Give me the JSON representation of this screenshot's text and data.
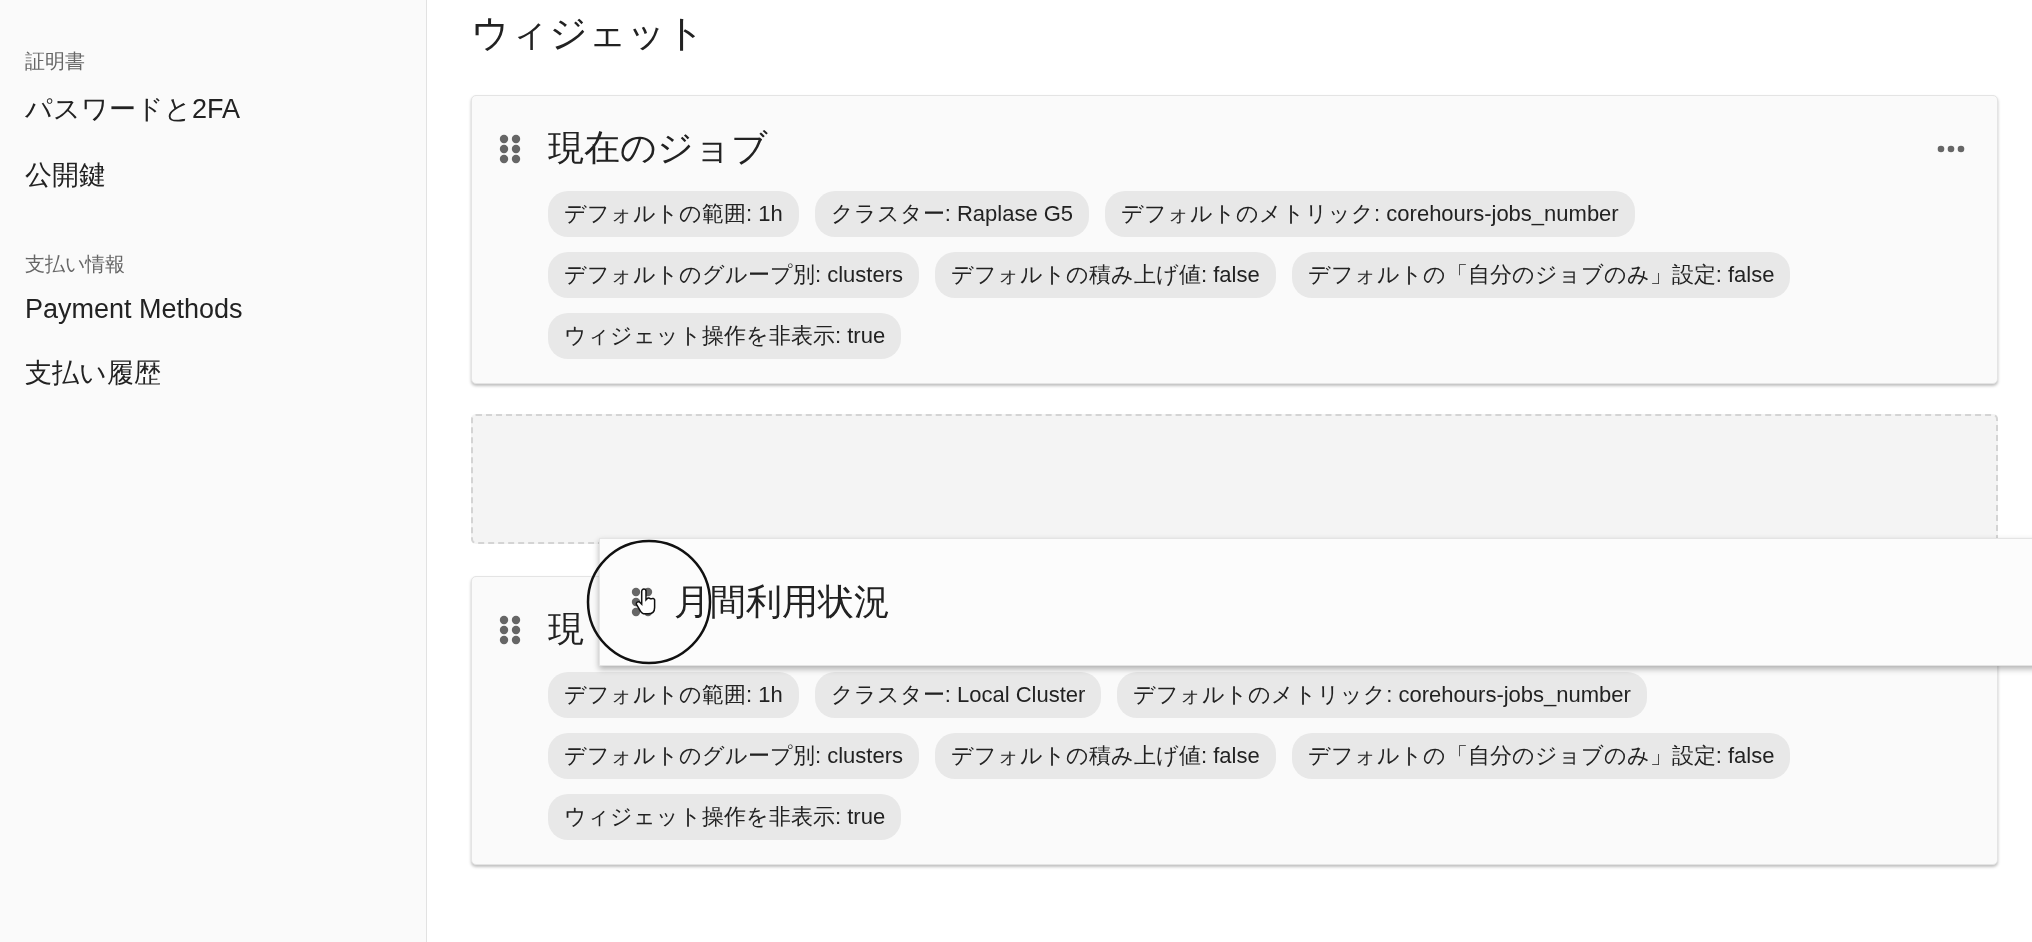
{
  "sidebar": {
    "sections": [
      {
        "heading": "証明書",
        "items": [
          {
            "label": "パスワードと2FA"
          },
          {
            "label": "公開鍵"
          }
        ]
      },
      {
        "heading": "支払い情報",
        "items": [
          {
            "label": "Payment Methods"
          },
          {
            "label": "支払い履歴"
          }
        ]
      }
    ]
  },
  "page_title": "ウィジェット",
  "widgets": [
    {
      "title": "現在のジョブ",
      "show_menu": true,
      "chips": [
        "デフォルトの範囲: 1h",
        "クラスター: Raplase G5",
        "デフォルトのメトリック: corehours-jobs_number",
        "デフォルトのグループ別: clusters",
        "デフォルトの積み上げ値: false",
        "デフォルトの「自分のジョブのみ」設定: false",
        "ウィジェット操作を非表示: true"
      ]
    },
    {
      "kind": "drop_placeholder"
    },
    {
      "title": "現",
      "chips": [
        "デフォルトの範囲: 1h",
        "クラスター: Local Cluster",
        "デフォルトのメトリック: corehours-jobs_number",
        "デフォルトのグループ別: clusters",
        "デフォルトの積み上げ値: false",
        "デフォルトの「自分のジョブのみ」設定: false",
        "ウィジェット操作を非表示: true"
      ]
    }
  ],
  "dragged_widget": {
    "title": "月間利用状況"
  }
}
